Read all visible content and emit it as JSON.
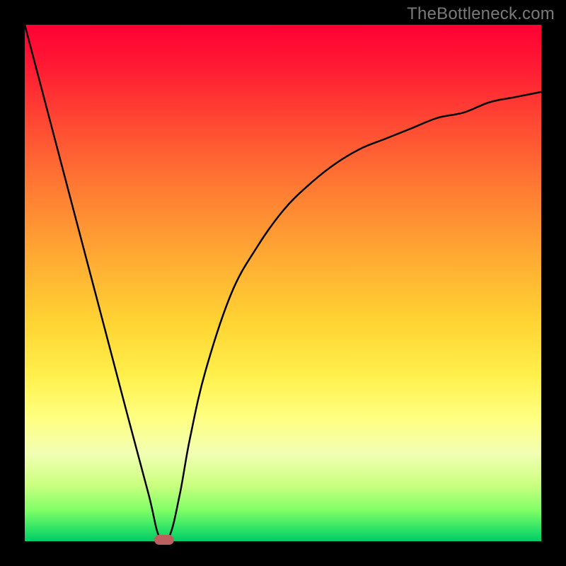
{
  "watermark": "TheBottleneck.com",
  "colors": {
    "frame": "#000000",
    "gradient_top": "#ff0033",
    "gradient_bottom": "#00cc66",
    "curve": "#000000",
    "marker": "#bb5f5f",
    "watermark_text": "#7a7a7a"
  },
  "chart_data": {
    "type": "line",
    "title": "",
    "xlabel": "",
    "ylabel": "",
    "xlim": [
      0,
      100
    ],
    "ylim": [
      0,
      100
    ],
    "grid": false,
    "legend": false,
    "series": [
      {
        "name": "bottleneck-curve",
        "x": [
          0,
          5,
          10,
          15,
          20,
          24,
          26,
          28,
          30,
          32,
          35,
          40,
          45,
          50,
          55,
          60,
          65,
          70,
          75,
          80,
          85,
          90,
          95,
          100
        ],
        "values": [
          100,
          81,
          62,
          43,
          24,
          9,
          1,
          1,
          9,
          20,
          33,
          48,
          57,
          64,
          69,
          73,
          76,
          78,
          80,
          82,
          83,
          85,
          86,
          87
        ]
      }
    ],
    "annotations": [
      {
        "name": "minimum-marker",
        "x": 27,
        "y": 0
      }
    ]
  }
}
